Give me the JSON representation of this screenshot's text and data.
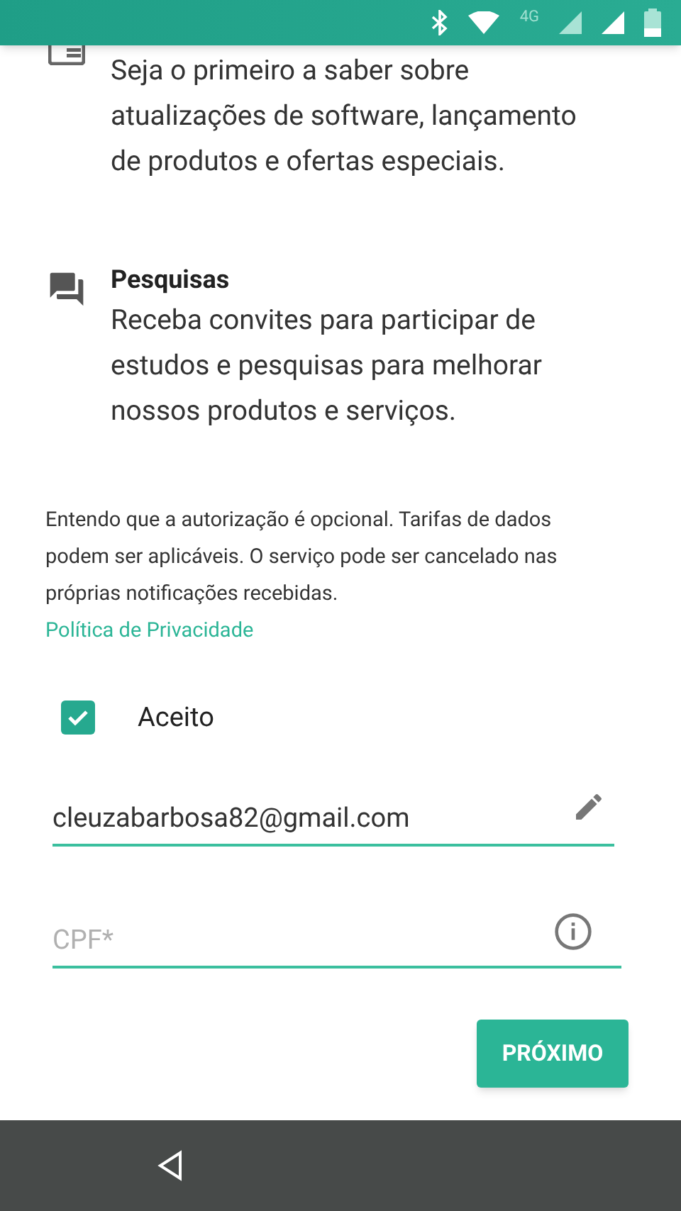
{
  "status_bar": {
    "network": "4G"
  },
  "sections": [
    {
      "kind": "news",
      "description": "Seja o primeiro a saber sobre atualizações de software, lançamento de produtos e ofertas especiais."
    },
    {
      "kind": "survey",
      "title": "Pesquisas",
      "description": "Receba convites para participar de estudos e pesquisas para melhorar nossos produtos e serviços."
    }
  ],
  "disclaimer": "Entendo que a autorização é opcional. Tarifas de dados podem ser aplicáveis. O serviço pode ser cancelado nas próprias notificações recebidas.",
  "privacy_link": "Política de Privacidade",
  "consent": {
    "label": "Aceito",
    "checked": true
  },
  "fields": [
    {
      "kind": "email",
      "value": "cleuzabarbosa82@gmail.com"
    },
    {
      "kind": "cpf",
      "placeholder": "CPF*"
    }
  ],
  "next_button": "PRÓXIMO"
}
